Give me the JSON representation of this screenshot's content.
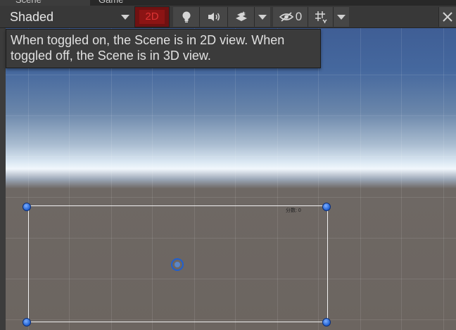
{
  "tabs": {
    "scene": "Scene",
    "game": "Game"
  },
  "toolbar": {
    "shading_mode": "Shaded",
    "toggle_2d_label": "2D",
    "gizmo_hidden_count": "0"
  },
  "tooltip": {
    "text": "When toggled on, the Scene is in 2D view. When toggled off, the Scene is in 3D view."
  },
  "scene": {
    "score_label": "分数: 0"
  },
  "colors": {
    "toggle_2d_active": "#8c1414",
    "handle_blue": "#1f5fd0",
    "sky_top": "#3f5e95",
    "ground": "#6c6560"
  }
}
